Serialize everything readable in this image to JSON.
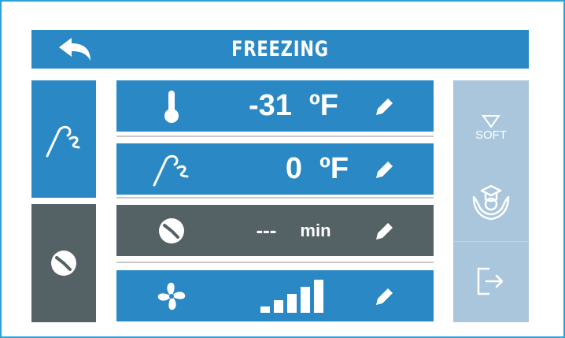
{
  "header": {
    "title": "FREEZING",
    "back_icon": "back-arrow-icon"
  },
  "sidebar": {
    "items": [
      {
        "icon": "probe-icon",
        "selected": true,
        "color": "#2a88c4"
      },
      {
        "icon": "clock-icon",
        "selected": false,
        "color": "#546165"
      }
    ]
  },
  "rows": {
    "temperature": {
      "icon": "thermometer-icon",
      "value": "-31",
      "unit": "ºF"
    },
    "probe": {
      "icon": "probe-icon",
      "value": "0",
      "unit": "ºF"
    },
    "time": {
      "icon": "clock-icon",
      "value": "---",
      "unit": "min"
    },
    "fan": {
      "icon": "fan-icon",
      "level": "5 of 5 bars"
    }
  },
  "right_panel": {
    "soft": {
      "label": "SOFT",
      "icon": "triangle-down-icon"
    },
    "teach_icon": "graduate-hands-icon",
    "exit_icon": "exit-icon"
  },
  "colors": {
    "primary": "#2a88c4",
    "dark": "#546165",
    "panel": "#a9c6dd",
    "frame": "#29a3d9"
  }
}
